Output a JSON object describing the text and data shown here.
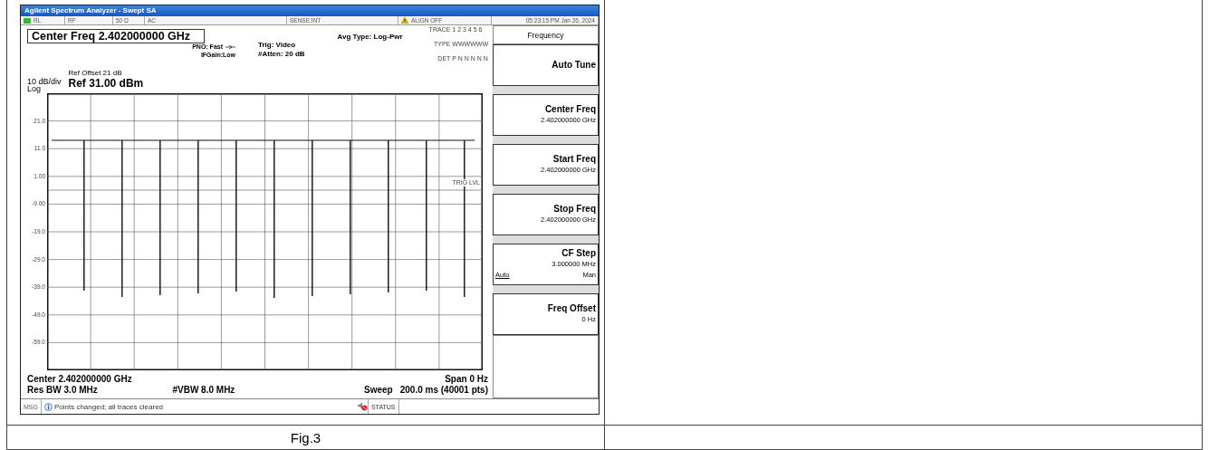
{
  "window": {
    "title": "Agilent Spectrum Analyzer - Swept SA"
  },
  "status_fields": [
    {
      "kind": "lxi",
      "text": "RL"
    },
    {
      "kind": "text",
      "text": "RF"
    },
    {
      "kind": "text",
      "text": "50 Ω"
    },
    {
      "kind": "text",
      "text": "AC"
    },
    {
      "kind": "text",
      "text": "SENSE:INT"
    },
    {
      "kind": "warning",
      "text": "ALIGN OFF"
    },
    {
      "kind": "text",
      "text": "05:23:15 PM Jan 26, 2024"
    }
  ],
  "header": {
    "center_freq": "Center Freq 2.402000000 GHz",
    "pno": "PNO: Fast",
    "ifgain": "IFGain:Low",
    "trig": "Trig: Video",
    "atten": "#Atten: 20 dB",
    "avg_type": "Avg Type: Log-Pwr",
    "trace_rows": [
      {
        "label": "TRACE",
        "values": "1 2 3 4 5 6"
      },
      {
        "label": "TYPE",
        "values": "WWWWWW"
      },
      {
        "label": "DET",
        "values": "P N N N N N"
      }
    ],
    "ref_offset": "Ref Offset 21 dB",
    "scale": "10 dB/div",
    "ref_level": "Ref 31.00 dBm",
    "scale_type": "Log"
  },
  "plot": {
    "y_labels": [
      "21.0",
      "11.0",
      "1.00",
      "-9.00",
      "-19.0",
      "-29.0",
      "-39.0",
      "-49.0",
      "-59.0"
    ],
    "trig_label": "TRIG LVL"
  },
  "footer": {
    "center": "Center 2.402000000 GHz",
    "span": "Span 0 Hz",
    "res_bw": "Res BW 3.0 MHz",
    "vbw": "#VBW 8.0 MHz",
    "sweep_label": "Sweep",
    "sweep": "200.0 ms (40001 pts)"
  },
  "message_bar": {
    "label": "MSG",
    "text": "Points changed; all traces cleared",
    "status": "STATUS"
  },
  "softkeys": {
    "menu_title": "Frequency",
    "keys": [
      {
        "label": "Auto Tune"
      },
      {
        "label": "Center Freq",
        "value": "2.402000000 GHz"
      },
      {
        "label": "Start Freq",
        "value": "2.402000000 GHz"
      },
      {
        "label": "Stop Freq",
        "value": "2.402000000 GHz"
      },
      {
        "label": "CF Step",
        "value": "3.000000 MHz",
        "options": [
          {
            "text": "Auto",
            "selected": true
          },
          {
            "text": "Man",
            "selected": false
          }
        ]
      },
      {
        "label": "Freq Offset",
        "value": "0 Hz"
      }
    ]
  },
  "document": {
    "caption": "Fig.3"
  }
}
